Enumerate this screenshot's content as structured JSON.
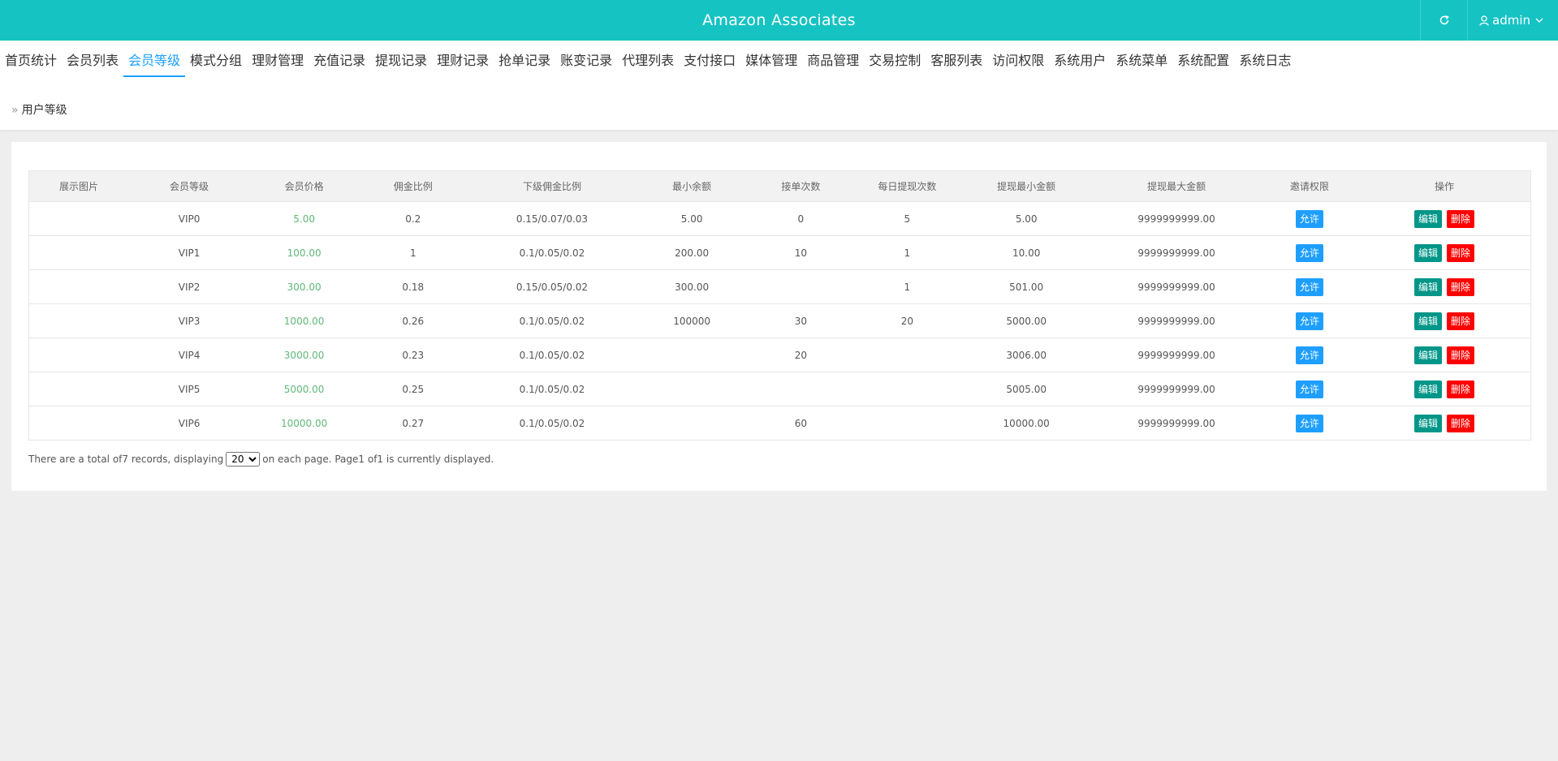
{
  "header": {
    "title": "Amazon Associates",
    "user": "admin"
  },
  "colors": {
    "topbar": "#16c3c3",
    "accent": "#1e9fff",
    "price": "#5fb878",
    "edit": "#009688",
    "delete": "#ff0000"
  },
  "icons": {
    "refresh": "refresh-icon",
    "user": "user-icon",
    "dropdown": "chevron-down-icon"
  },
  "nav": {
    "tabs": [
      "首页统计",
      "会员列表",
      "会员等级",
      "模式分组",
      "理财管理",
      "充值记录",
      "提现记录",
      "理财记录",
      "抢单记录",
      "账变记录",
      "代理列表",
      "支付接口",
      "媒体管理",
      "商品管理",
      "交易控制",
      "客服列表",
      "访问权限",
      "系统用户",
      "系统菜单",
      "系统配置",
      "系统日志"
    ],
    "active": 2
  },
  "breadcrumb": {
    "sep": "»",
    "label": "用户等级"
  },
  "table": {
    "headers": [
      "展示图片",
      "会员等级",
      "会员价格",
      "佣金比例",
      "下级佣金比例",
      "最小余额",
      "接单次数",
      "每日提现次数",
      "提现最小金额",
      "提现最大金额",
      "邀请权限",
      "操作"
    ],
    "allow_label": "允许",
    "edit_label": "编辑",
    "delete_label": "删除",
    "rows": [
      [
        "",
        "VIP0",
        "5.00",
        "0.2",
        "0.15/0.07/0.03",
        "5.00",
        "0",
        "5",
        "5.00",
        "9999999999.00"
      ],
      [
        "",
        "VIP1",
        "100.00",
        "1",
        "0.1/0.05/0.02",
        "200.00",
        "10",
        "1",
        "10.00",
        "9999999999.00"
      ],
      [
        "",
        "VIP2",
        "300.00",
        "0.18",
        "0.15/0.05/0.02",
        "300.00",
        "",
        "1",
        "501.00",
        "9999999999.00"
      ],
      [
        "",
        "VIP3",
        "1000.00",
        "0.26",
        "0.1/0.05/0.02",
        "100000",
        "30",
        "20",
        "5000.00",
        "9999999999.00"
      ],
      [
        "",
        "VIP4",
        "3000.00",
        "0.23",
        "0.1/0.05/0.02",
        "",
        "20",
        "",
        "3006.00",
        "9999999999.00"
      ],
      [
        "",
        "VIP5",
        "5000.00",
        "0.25",
        "0.1/0.05/0.02",
        "",
        "",
        "",
        "5005.00",
        "9999999999.00"
      ],
      [
        "",
        "VIP6",
        "10000.00",
        "0.27",
        "0.1/0.05/0.02",
        "",
        "60",
        "",
        "10000.00",
        "9999999999.00"
      ]
    ]
  },
  "pager": {
    "prefix": "There are a total of7 records, displaying",
    "page_size": "20",
    "suffix": "on each page. Page1 of1 is currently displayed."
  }
}
